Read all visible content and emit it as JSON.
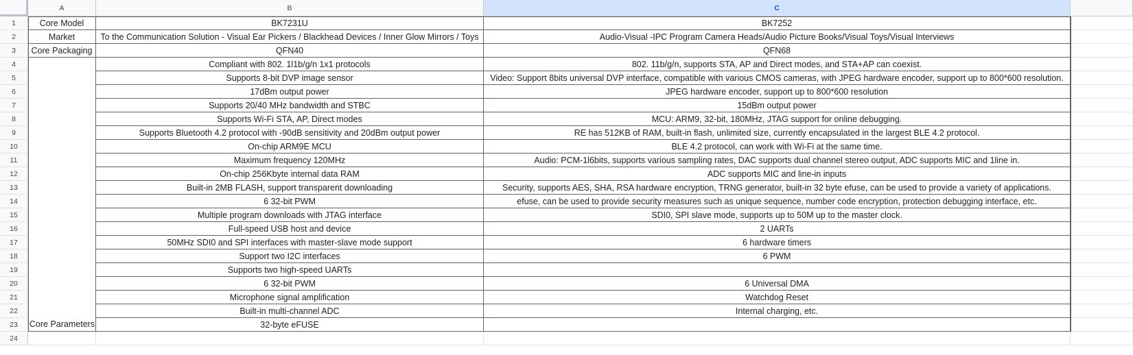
{
  "columns": [
    "A",
    "B",
    "C"
  ],
  "rows": [
    {
      "num": "1",
      "a": "Core Model",
      "b": "BK7231U",
      "c": "BK7252"
    },
    {
      "num": "2",
      "a": "Market",
      "b": "To the Communication Solution - Visual Ear Pickers / Blackhead Devices / Inner Glow Mirrors / Toys",
      "c": "Audio-Visual -IPC Program Camera Heads/Audio Picture Books/Visual Toys/Visual Interviews"
    },
    {
      "num": "3",
      "a": "Core Packaging",
      "b": "QFN40",
      "c": "QFN68"
    },
    {
      "num": "4",
      "a": "",
      "b": "Compliant with 802. 1l1b/g/n 1x1 protocols",
      "c": "802. 11b/g/n, supports STA, AP and Direct modes, and STA+AP can coexist."
    },
    {
      "num": "5",
      "a": "",
      "b": "Supports 8-bit DVP image sensor",
      "c": "Video: Support 8bits universal DVP interface, compatible with various CMOS cameras, with JPEG hardware encoder, support up to 800*600 resolution."
    },
    {
      "num": "6",
      "a": "",
      "b": "17dBm output power",
      "c": "JPEG hardware encoder, support up to 800*600 resolution"
    },
    {
      "num": "7",
      "a": "",
      "b": "Supports 20/40 MHz bandwidth and STBC",
      "c": "15dBm output power"
    },
    {
      "num": "8",
      "a": "",
      "b": "Supports Wi-Fi STA, AP, Direct modes",
      "c": "MCU: ARM9, 32-bit, 180MHz, JTAG support for online debugging."
    },
    {
      "num": "9",
      "a": "",
      "b": "Supports Bluetooth 4.2 protocol with -90dB sensitivity and 20dBm output power",
      "c": "RE has 512KB of RAM, built-in flash, unlimited size, currently encapsulated in the largest BLE 4.2 protocol."
    },
    {
      "num": "10",
      "a": "",
      "b": "On-chip ARM9E MCU",
      "c": "BLE 4.2 protocol, can work with Wi-Fi at the same time."
    },
    {
      "num": "11",
      "a": "",
      "b": "Maximum frequency 120MHz",
      "c": "Audio: PCM-1l6bits, supports various sampling rates, DAC supports dual channel stereo output, ADC supports MIC and 1line in."
    },
    {
      "num": "12",
      "a": "",
      "b": "On-chip 256Kbyte internal data RAM",
      "c": "ADC supports MIC and line-in inputs"
    },
    {
      "num": "13",
      "a": "",
      "b": "Built-in 2MB FLASH, support transparent downloading",
      "c": "Security, supports AES, SHA, RSA hardware encryption, TRNG generator, built-in 32 byte efuse, can be used to provide a variety of applications."
    },
    {
      "num": "14",
      "a": "",
      "b": "6 32-bit PWM",
      "c": "efuse, can be used to provide security measures such as unique sequence, number code encryption, protection debugging interface, etc."
    },
    {
      "num": "15",
      "a": "",
      "b": "Multiple program downloads with JTAG interface",
      "c": "SDI0, SPI slave mode, supports up to 50M up to the master clock."
    },
    {
      "num": "16",
      "a": "",
      "b": "Full-speed USB host and device",
      "c": "2 UARTs"
    },
    {
      "num": "17",
      "a": "",
      "b": "50MHz SDI0 and SPI interfaces with master-slave mode support",
      "c": "6 hardware timers"
    },
    {
      "num": "18",
      "a": "",
      "b": "Support two I2C interfaces",
      "c": "6 PWM"
    },
    {
      "num": "19",
      "a": "",
      "b": "Supports two high-speed UARTs",
      "c": ""
    },
    {
      "num": "20",
      "a": "",
      "b": "6 32-bit PWM",
      "c": "6 Universal DMA"
    },
    {
      "num": "21",
      "a": "",
      "b": "Microphone signal amplification",
      "c": "Watchdog Reset"
    },
    {
      "num": "22",
      "a": "",
      "b": "Built-in multi-channel ADC",
      "c": "Internal charging, etc."
    },
    {
      "num": "23",
      "a": "",
      "b": "32-byte eFUSE",
      "c": ""
    },
    {
      "num": "24",
      "a": "",
      "b": "",
      "c": ""
    }
  ],
  "merged_label": "Core Parameters",
  "colors": {
    "header_bg": "#f8f9fa",
    "selected_header_bg": "#d3e3fd",
    "selected_header_text": "#0b57d0",
    "gridline": "#e2e3e3",
    "table_border": "#5f6368"
  }
}
